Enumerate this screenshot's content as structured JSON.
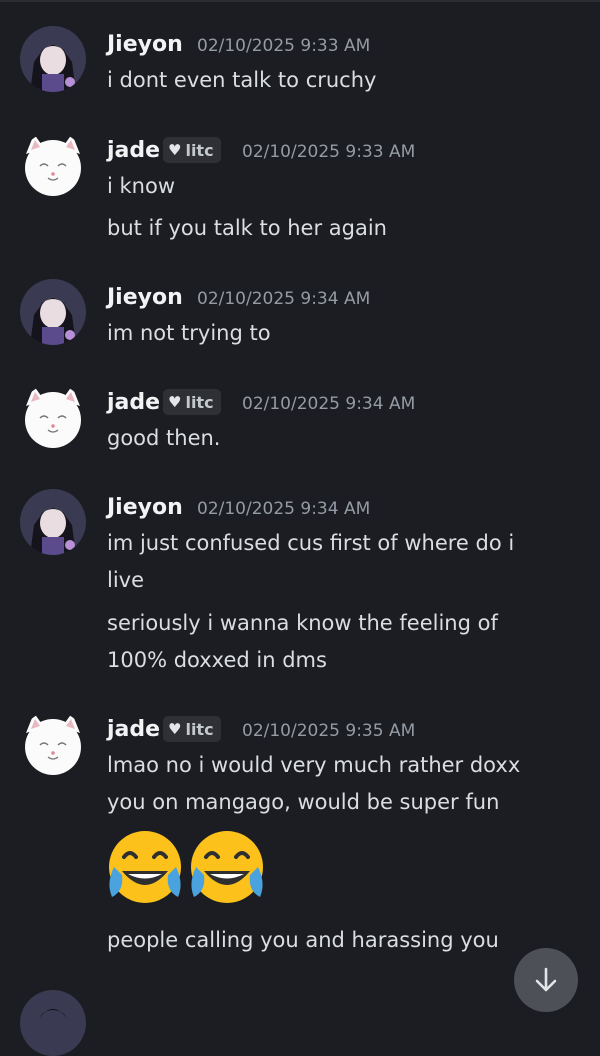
{
  "messages": [
    {
      "author": "Jieyon",
      "tag": "",
      "timestamp": "02/10/2025 9:33 AM",
      "lines": [
        "i dont even talk to cruchy"
      ]
    },
    {
      "author": "jade",
      "tag": "litc",
      "timestamp": "02/10/2025 9:33 AM",
      "lines": [
        "i know",
        "but if you talk to her again"
      ]
    },
    {
      "author": "Jieyon",
      "tag": "",
      "timestamp": "02/10/2025 9:34 AM",
      "lines": [
        "im not trying to"
      ]
    },
    {
      "author": "jade",
      "tag": "litc",
      "timestamp": "02/10/2025 9:34 AM",
      "lines": [
        "good then."
      ]
    },
    {
      "author": "Jieyon",
      "tag": "",
      "timestamp": "02/10/2025 9:34 AM",
      "lines": [
        "im just confused cus first of where do i",
        "live",
        "seriously i wanna know the feeling of",
        "100% doxxed in dms"
      ]
    },
    {
      "author": "jade",
      "tag": "litc",
      "timestamp": "02/10/2025 9:35 AM",
      "lines": [
        "lmao no i would very much rather doxx",
        "you on mangago, would be super fun",
        "people calling you and harassing you"
      ],
      "emojis": [
        "joy-emoji",
        "joy-emoji"
      ]
    }
  ],
  "colors": {
    "background": "#1c1d22",
    "text": "#dbdee1",
    "timestamp": "#949ba4",
    "scroll_button": "#4e5058"
  },
  "icons": {
    "tag_icon": "heart-icon",
    "scroll": "arrow-down-icon"
  }
}
